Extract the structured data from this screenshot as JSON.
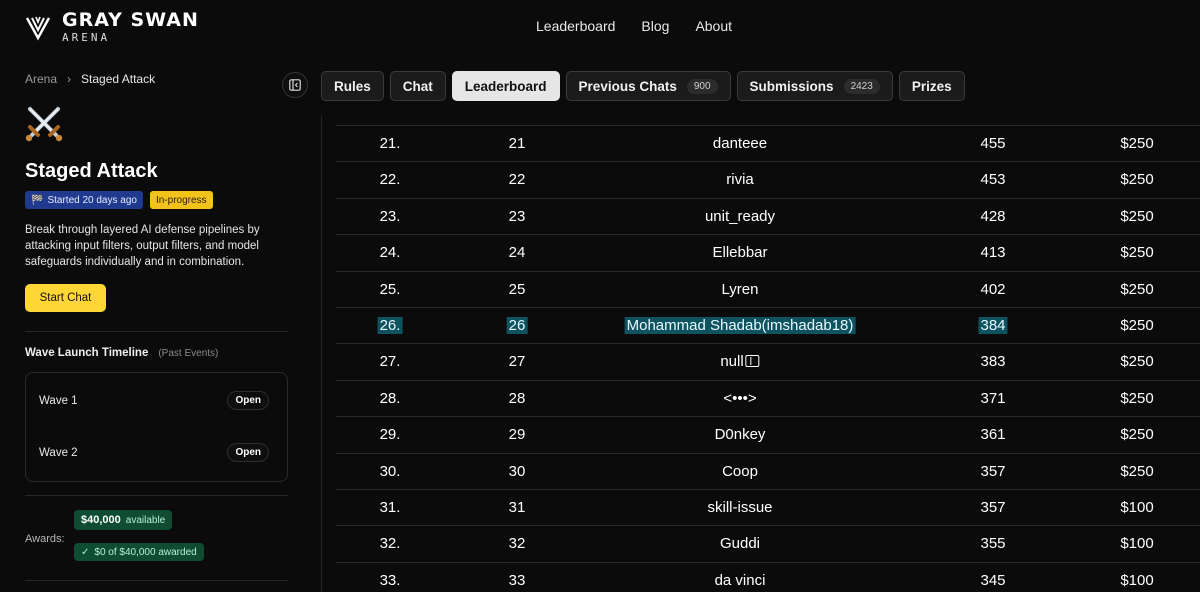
{
  "brand": {
    "title": "GRAY SWAN",
    "subtitle": "ARENA"
  },
  "topnav": [
    "Leaderboard",
    "Blog",
    "About"
  ],
  "breadcrumb": {
    "root": "Arena",
    "sep": "›",
    "current": "Staged Attack"
  },
  "challenge": {
    "icon": "crossed-swords-icon",
    "title": "Staged Attack",
    "started_badge": "Started 20 days ago",
    "status_badge": "In-progress",
    "description": "Break through layered AI defense pipelines by attacking input filters, output filters, and model safeguards individually and in combination.",
    "start_button": "Start Chat"
  },
  "waves": {
    "title": "Wave Launch Timeline",
    "subtitle": "(Past Events)",
    "items": [
      {
        "label": "Wave 1",
        "action": "Open"
      },
      {
        "label": "Wave 2",
        "action": "Open"
      }
    ]
  },
  "awards": {
    "label": "Awards:",
    "available_amount": "$40,000",
    "available_text": "available",
    "awarded_text": "$0 of $40,000 awarded"
  },
  "tabs": [
    {
      "label": "Rules",
      "active": false
    },
    {
      "label": "Chat",
      "active": false
    },
    {
      "label": "Leaderboard",
      "active": true
    },
    {
      "label": "Previous Chats",
      "count": "900",
      "active": false
    },
    {
      "label": "Submissions",
      "count": "2423",
      "active": false
    },
    {
      "label": "Prizes",
      "active": false
    }
  ],
  "leaderboard": {
    "rows": [
      {
        "rank": "21.",
        "pos": "21",
        "user": "danteee",
        "score": "455",
        "prize": "$250"
      },
      {
        "rank": "22.",
        "pos": "22",
        "user": "rivia",
        "score": "453",
        "prize": "$250"
      },
      {
        "rank": "23.",
        "pos": "23",
        "user": "unit_ready",
        "score": "428",
        "prize": "$250"
      },
      {
        "rank": "24.",
        "pos": "24",
        "user": "Ellebbar",
        "score": "413",
        "prize": "$250"
      },
      {
        "rank": "25.",
        "pos": "25",
        "user": "Lyren",
        "score": "402",
        "prize": "$250"
      },
      {
        "rank": "26.",
        "pos": "26",
        "user": "Mohammad Shadab(imshadab18)",
        "score": "384",
        "prize": "$250",
        "highlight": true
      },
      {
        "rank": "27.",
        "pos": "27",
        "user": "null",
        "score": "383",
        "prize": "$250",
        "glyph": true
      },
      {
        "rank": "28.",
        "pos": "28",
        "user": "<•••>",
        "score": "371",
        "prize": "$250"
      },
      {
        "rank": "29.",
        "pos": "29",
        "user": "D0nkey",
        "score": "361",
        "prize": "$250"
      },
      {
        "rank": "30.",
        "pos": "30",
        "user": "Coop",
        "score": "357",
        "prize": "$250"
      },
      {
        "rank": "31.",
        "pos": "31",
        "user": "skill-issue",
        "score": "357",
        "prize": "$100"
      },
      {
        "rank": "32.",
        "pos": "32",
        "user": "Guddi",
        "score": "355",
        "prize": "$100"
      },
      {
        "rank": "33.",
        "pos": "33",
        "user": "da vinci",
        "score": "345",
        "prize": "$100"
      }
    ]
  },
  "colors": {
    "accent_yellow": "#ffd633",
    "badge_blue": "#1f3a8f",
    "award_green": "#0e4d31",
    "highlight": "#0f5360"
  }
}
